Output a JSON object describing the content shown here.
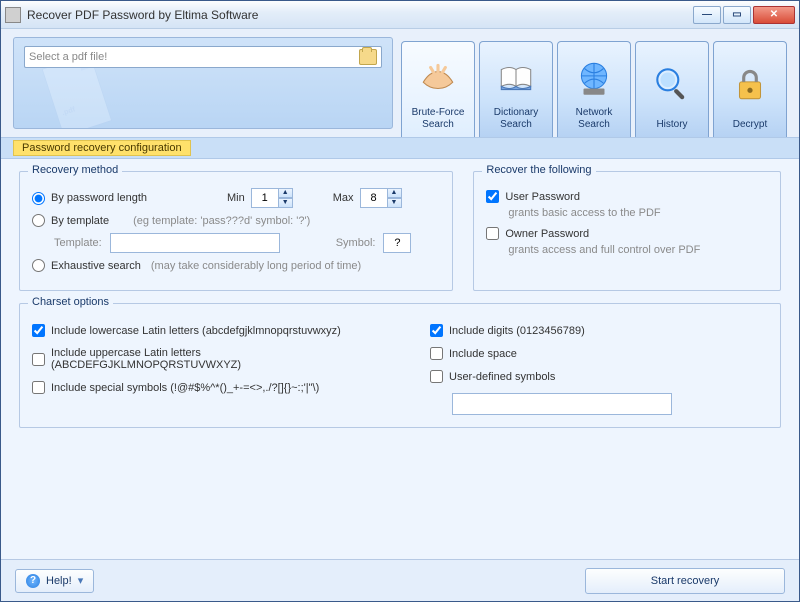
{
  "window": {
    "title": "Recover PDF Password by Eltima Software"
  },
  "file_picker": {
    "placeholder": "Select a pdf file!"
  },
  "tabs": {
    "brute": "Brute-Force Search",
    "dictionary": "Dictionary Search",
    "network": "Network Search",
    "history": "History",
    "decrypt": "Decrypt"
  },
  "config_bar": {
    "label": "Password recovery configuration"
  },
  "recovery_method": {
    "legend": "Recovery method",
    "by_length": "By password length",
    "min_label": "Min",
    "min_value": "1",
    "max_label": "Max",
    "max_value": "8",
    "by_template": "By template",
    "template_hint": "(eg template: 'pass???d' symbol: '?')",
    "template_label": "Template:",
    "template_value": "",
    "symbol_label": "Symbol:",
    "symbol_value": "?",
    "exhaustive": "Exhaustive search",
    "exhaustive_hint": "(may take considerably long period of time)"
  },
  "recover_following": {
    "legend": "Recover the following",
    "user_pw": "User Password",
    "user_pw_hint": "grants basic access to the PDF",
    "owner_pw": "Owner Password",
    "owner_pw_hint": "grants access and full control over PDF"
  },
  "charset": {
    "legend": "Charset options",
    "lowercase": "Include lowercase Latin letters (abcdefgjklmnopqrstuvwxyz)",
    "uppercase": "Include uppercase Latin letters (ABCDEFGJKLMNOPQRSTUVWXYZ)",
    "special": "Include special symbols (!@#$%^*()_+-=<>,./?[]{}~:;'|\"\\)",
    "digits": "Include digits (0123456789)",
    "space": "Include space",
    "userdef": "User-defined symbols",
    "userdef_value": ""
  },
  "footer": {
    "help": "Help!",
    "start": "Start recovery"
  }
}
